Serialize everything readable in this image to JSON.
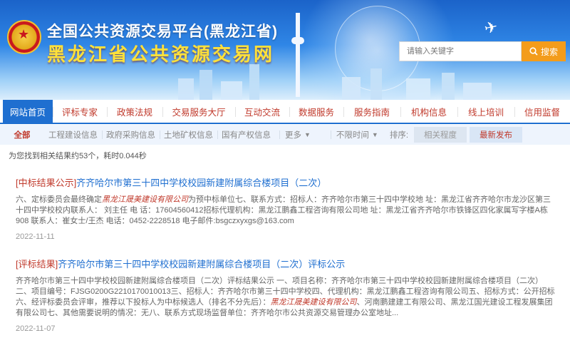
{
  "header": {
    "title_line1": "全国公共资源交易平台(黑龙江省)",
    "title_line2": "黑龙江省公共资源交易网",
    "search_placeholder": "请输入关键字",
    "search_button": "搜索"
  },
  "nav": {
    "items": [
      "网站首页",
      "评标专家",
      "政策法规",
      "交易服务大厅",
      "互动交流",
      "数据服务",
      "服务指南",
      "机构信息",
      "线上培训",
      "信用监督"
    ]
  },
  "filter": {
    "all_label": "全部",
    "categories": [
      "工程建设信息",
      "政府采购信息",
      "土地矿权信息",
      "国有产权信息"
    ],
    "more_label": "更多",
    "limit_label": "不限时间",
    "sort_label": "排序:",
    "sort_relevance": "相关程度",
    "sort_latest": "最新发布"
  },
  "results": {
    "summary": "为您找到相关结果约53个，耗时0.044秒",
    "items": [
      {
        "tag": "[中标结果公示]",
        "title": "齐齐哈尔市第三十四中学校校园新建附属综合楼项目（二次）",
        "body_pre": "六、定标委员会最终确定",
        "body_highlight": "黑龙江晟美建设有限公司",
        "body_post": "为预中标单位七、联系方式：招标人：齐齐哈尔市第三十四中学校地  址：黑龙江省齐齐哈尔市龙沙区第三十四中学校校内联系人：  刘主任  电  话：17604560412招标代理机构：黑龙江鹏鑫工程咨询有限公司地    址：黑龙江省齐齐哈尔市铁锋区四化家属写字楼A栋908 联系人：崔女士/王杰  电话：0452-2228518  电子邮件:bsgczxyxgs@163.com",
        "date": "2022-11-11"
      },
      {
        "tag": "[评标结果]",
        "title": "齐齐哈尔市第三十四中学校校园新建附属综合楼项目（二次）评标公示",
        "body_pre": "齐齐哈尔市第三十四中学校校园新建附属综合楼项目（二次）评标结果公示 一、项目名称：齐齐哈尔市第三十四中学校校园新建附属综合楼项目（二次）二、项目编号：FJSG0200G2210170010013三、招标人：齐齐哈尔市第三十四中学校四、代理机构：黑龙江鹏鑫工程咨询有限公司五、招标方式：公开招标六、经评标委员会评审，推荐以下投标人为中标候选人（排名不分先后）：",
        "body_highlight": "黑龙江晟美建设有限公司",
        "body_post": "、河南鹏建建工有限公司、黑龙江国光建设工程发展集团有限公司七、其他需要说明的情况：无八、联系方式现场监督单位：齐齐哈尔市公共资源交易管理办公室地址...",
        "date": "2022-11-07"
      }
    ]
  }
}
